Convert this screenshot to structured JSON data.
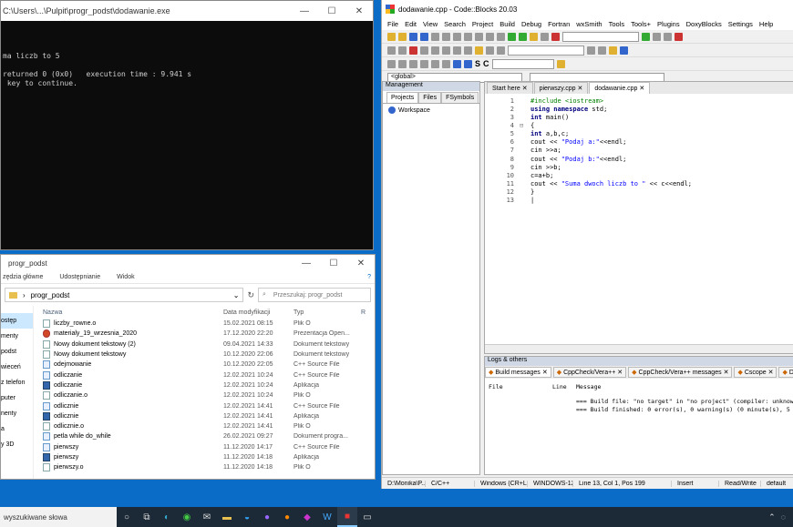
{
  "console": {
    "title": "C:\\Users\\...\\Pulpit\\progr_podst\\dodawanie.exe",
    "output": "ma liczb to 5\n\nreturned 0 (0x0)   execution time : 9.941 s\n key to continue."
  },
  "explorer": {
    "title": "progr_podst",
    "ribbon": [
      "zędzia główne",
      "Udostępnianie",
      "Widok"
    ],
    "address": "progr_podst",
    "search_placeholder": "Przeszukaj: progr_podst",
    "nav": [
      "ostęp",
      "menty",
      "podst",
      "wieceń",
      "z telefon",
      "puter",
      "nenty",
      "a",
      "y 3D"
    ],
    "columns": {
      "name": "Nazwa",
      "date": "Data modyfikacji",
      "type": "Typ",
      "size": "R"
    },
    "files": [
      {
        "name": "liczby_rowne.o",
        "date": "15.02.2021 08:15",
        "type": "Plik O",
        "icon": "file"
      },
      {
        "name": "materialy_19_wrzesnia_2020",
        "date": "17.12.2020 22:20",
        "type": "Prezentacja Open...",
        "icon": "ppt"
      },
      {
        "name": "Nowy dokument tekstowy (2)",
        "date": "09.04.2021 14:33",
        "type": "Dokument tekstowy",
        "icon": "file"
      },
      {
        "name": "Nowy dokument tekstowy",
        "date": "10.12.2020 22:06",
        "type": "Dokument tekstowy",
        "icon": "file"
      },
      {
        "name": "odejmowanie",
        "date": "10.12.2020 22:05",
        "type": "C++ Source File",
        "icon": "src"
      },
      {
        "name": "odliczanie",
        "date": "12.02.2021 10:24",
        "type": "C++ Source File",
        "icon": "src"
      },
      {
        "name": "odliczanie",
        "date": "12.02.2021 10:24",
        "type": "Aplikacja",
        "icon": "app"
      },
      {
        "name": "odliczanie.o",
        "date": "12.02.2021 10:24",
        "type": "Plik O",
        "icon": "file"
      },
      {
        "name": "odlicznie",
        "date": "12.02.2021 14:41",
        "type": "C++ Source File",
        "icon": "src"
      },
      {
        "name": "odlicznie",
        "date": "12.02.2021 14:41",
        "type": "Aplikacja",
        "icon": "app"
      },
      {
        "name": "odlicznie.o",
        "date": "12.02.2021 14:41",
        "type": "Plik O",
        "icon": "file"
      },
      {
        "name": "petla while do_while",
        "date": "26.02.2021 09:27",
        "type": "Dokument progra...",
        "icon": "src"
      },
      {
        "name": "pierwszy",
        "date": "11.12.2020 14:17",
        "type": "C++ Source File",
        "icon": "src"
      },
      {
        "name": "pierwszy",
        "date": "11.12.2020 14:18",
        "type": "Aplikacja",
        "icon": "app"
      },
      {
        "name": "pierwszy.o",
        "date": "11.12.2020 14:18",
        "type": "Plik O",
        "icon": "file"
      }
    ]
  },
  "codeblocks": {
    "title": "dodawanie.cpp - Code::Blocks 20.03",
    "menu": [
      "File",
      "Edit",
      "View",
      "Search",
      "Project",
      "Build",
      "Debug",
      "Fortran",
      "wxSmith",
      "Tools",
      "Tools+",
      "Plugins",
      "DoxyBlocks",
      "Settings",
      "Help"
    ],
    "global_scope": "<global>",
    "management": {
      "title": "Management",
      "tabs": [
        "Projects",
        "Files",
        "FSymbols"
      ],
      "workspace": "Workspace"
    },
    "editor_tabs": [
      "Start here",
      "pierwszy.cpp",
      "dodawanie.cpp"
    ],
    "logs": {
      "title": "Logs & others",
      "tabs": [
        "Build messages",
        "CppCheck/Vera++",
        "CppCheck/Vera++ messages",
        "Cscope",
        "Doxy"
      ],
      "columns": [
        "File",
        "Line",
        "Message"
      ],
      "lines": [
        "=== Build file: \"no target\" in \"no project\" (compiler: unknown)",
        "=== Build finished: 0 error(s), 0 warning(s) (0 minute(s), 5 se"
      ]
    },
    "status": [
      "D:\\Monika\\P...",
      "C/C++",
      "Windows (CR+LF)",
      "WINDOWS-1250",
      "Line 13, Col 1, Pos 199",
      "Insert",
      "Read/Write",
      "default"
    ]
  },
  "taskbar": {
    "search_placeholder": "wyszukiwane słowa"
  }
}
